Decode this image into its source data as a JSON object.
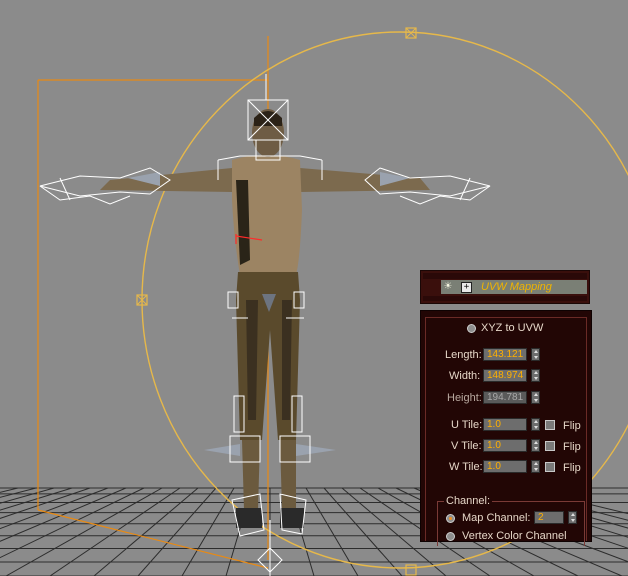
{
  "viewport": {
    "colors": {
      "background": "#8b8b8b",
      "grid": "#2c2c2c",
      "gizmo_circle": "#e6b84a",
      "bbox": "#e88a14",
      "bones": "#ffffff"
    }
  },
  "modifier_stack": {
    "item_name": "UVW Mapping",
    "icons": {
      "light": "lightbulb-icon",
      "expand": "plus-icon"
    }
  },
  "parameters": {
    "xyz_to_uvw_label": "XYZ to UVW",
    "length": {
      "label": "Length:",
      "value": "143.121"
    },
    "width": {
      "label": "Width:",
      "value": "148.974"
    },
    "height": {
      "label": "Height:",
      "value": "194.781"
    },
    "u_tile": {
      "label": "U Tile:",
      "value": "1.0",
      "flip_label": "Flip"
    },
    "v_tile": {
      "label": "V Tile:",
      "value": "1.0",
      "flip_label": "Flip"
    },
    "w_tile": {
      "label": "W Tile:",
      "value": "1.0",
      "flip_label": "Flip"
    },
    "channel_group_label": "Channel:",
    "map_channel": {
      "label": "Map Channel:",
      "value": "2",
      "selected": true
    },
    "vertex_color_channel_label": "Vertex Color Channel",
    "colors": {
      "accent_value": "#ffb000",
      "panel_bg": "#220605"
    }
  }
}
